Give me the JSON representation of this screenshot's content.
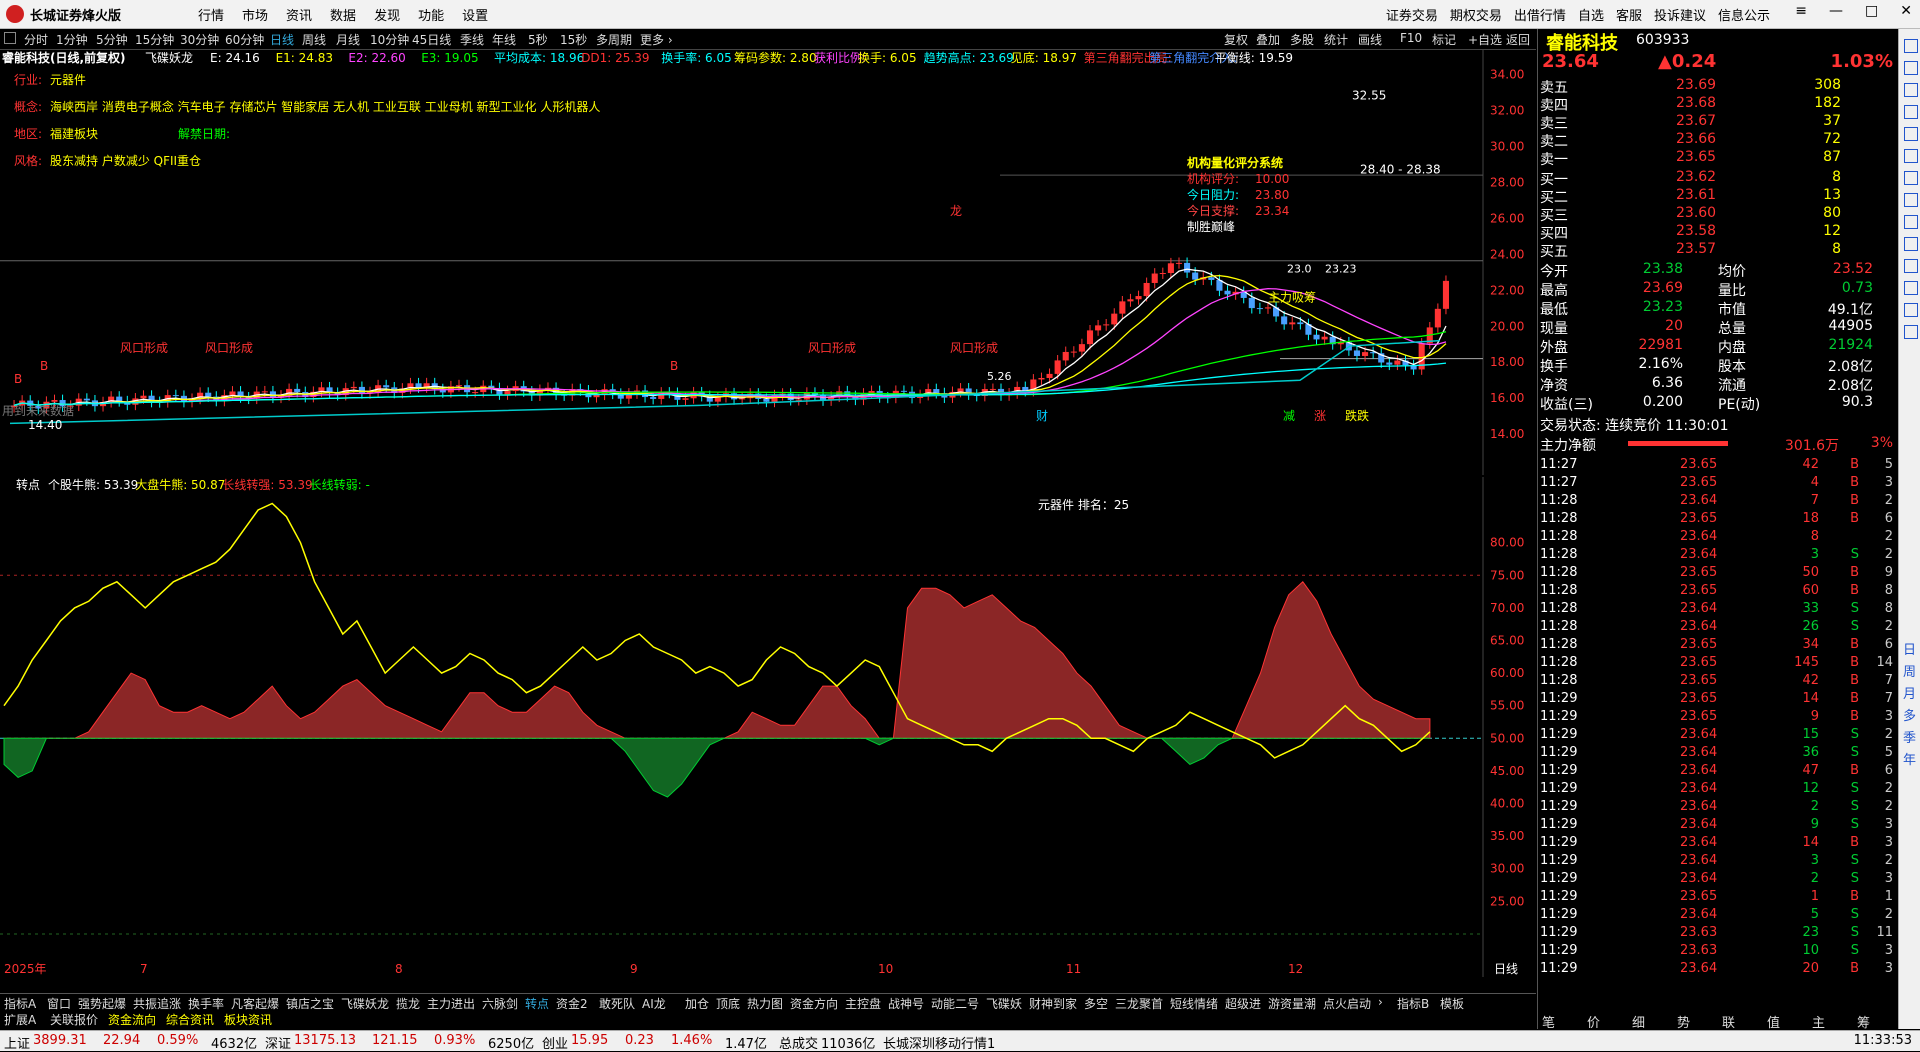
{
  "app": {
    "title": "长城证券烽火版"
  },
  "mainmenu": [
    "行情",
    "市场",
    "资讯",
    "数据",
    "发现",
    "功能",
    "设置"
  ],
  "rightmenu": [
    "证券交易",
    "期权交易",
    "出借行情",
    "自选",
    "客服",
    "投诉建议",
    "信息公示"
  ],
  "window_buttons": [
    "≡",
    "—",
    "□",
    "✕"
  ],
  "periods": [
    "分时",
    "1分钟",
    "5分钟",
    "15分钟",
    "30分钟",
    "60分钟",
    "日线",
    "周线",
    "月线",
    "10分钟",
    "45日线",
    "季线",
    "年线",
    "5秒",
    "15秒",
    "多周期",
    "更多 ›"
  ],
  "active_period": "日线",
  "toolbar": [
    "复权",
    "叠加",
    "多股",
    "统计",
    "画线",
    "F10",
    "标记",
    "+自选",
    "返回"
  ],
  "main_header": {
    "stock": "睿能科技(日线,前复权)",
    "indicator": "飞碟妖龙",
    "items": [
      {
        "t": "E: 24.16",
        "c": "#ffffff"
      },
      {
        "t": "E1: 24.83",
        "c": "#ffff00"
      },
      {
        "t": "E2: 22.60",
        "c": "#ff44ff"
      },
      {
        "t": "E3: 19.05",
        "c": "#00ff00"
      },
      {
        "t": "平均成本: 18.96",
        "c": "#00ffff"
      },
      {
        "t": "DD1: 25.39",
        "c": "#ff3333"
      },
      {
        "t": "换手率: 6.05",
        "c": "#00ffff"
      },
      {
        "t": "筹码参数: 2.80",
        "c": "#ffff00"
      },
      {
        "t": "获利比例:",
        "c": "#ff44ff"
      },
      {
        "t": "换手: 6.05",
        "c": "#ffff00"
      },
      {
        "t": "趋势高点: 23.69",
        "c": "#00ffff"
      },
      {
        "t": "见底: 18.97",
        "c": "#ffff00"
      },
      {
        "t": "第三角翻完出局:",
        "c": "#ff3333"
      },
      {
        "t": "第三角翻完介入:",
        "c": "#4488ff"
      },
      {
        "t": "平衡线: 19.59",
        "c": "#ffffff"
      }
    ]
  },
  "info_lines": [
    {
      "label": "行业:",
      "value": "元器件"
    },
    {
      "label": "概念:",
      "value": "海峡西岸 消费电子概念 汽车电子 存储芯片 智能家居 无人机 工业互联 工业母机 新型工业化 人形机器人"
    },
    {
      "label": "地区:",
      "value": "福建板块",
      "extra": "解禁日期:"
    },
    {
      "label": "风格:",
      "value": "股东减持 户数减少 QFII重仓"
    }
  ],
  "overlay": {
    "title": "机构量化评分系统",
    "rows": [
      {
        "k": "机构评分:",
        "v": "10.00"
      },
      {
        "k": "今日阻力:",
        "v": "23.80"
      },
      {
        "k": "今日支撑:",
        "v": "23.34"
      },
      {
        "k": "制胜巅峰",
        "v": ""
      }
    ]
  },
  "price_labels": {
    "high": "32.55",
    "range": "28.40 - 28.38",
    "low": "14.40",
    "mid": "23.0",
    "mid2": "23.23",
    "p1": "5.26"
  },
  "chart_annotations": [
    "风口形成",
    "风口形成",
    "风口形成",
    "风口形成",
    "主力吸筹",
    "B",
    "B",
    "B",
    "龙",
    "用到未来数据",
    "财",
    "减",
    "涨",
    "跌跌"
  ],
  "main_yaxis": [
    "34.00",
    "32.00",
    "30.00",
    "28.00",
    "26.00",
    "24.00",
    "22.00",
    "20.00",
    "18.00",
    "16.00",
    "14.00"
  ],
  "sub_header": {
    "name": "转点",
    "items": [
      {
        "t": "个股牛熊: 53.39",
        "c": "#ffffff"
      },
      {
        "t": "大盘牛熊: 50.87",
        "c": "#ffff00"
      },
      {
        "t": "长线转强: 53.39",
        "c": "#ff3333"
      },
      {
        "t": "长线转弱: -",
        "c": "#00ff00"
      }
    ]
  },
  "sub_center": "元器件    排名：25",
  "sub_yaxis": [
    "80.00",
    "75.00",
    "70.00",
    "65.00",
    "60.00",
    "55.00",
    "50.00",
    "45.00",
    "40.00",
    "35.00",
    "30.00",
    "25.00"
  ],
  "xaxis_dates": [
    "2025年",
    "7",
    "8",
    "9",
    "10",
    "11",
    "12"
  ],
  "xaxis_right": "日线",
  "bottom_tabs": [
    "指标A",
    "窗口",
    "强势起爆",
    "共振追涨",
    "换手率",
    "凡客起爆",
    "镇店之宝",
    "飞碟妖龙",
    "揽龙",
    "主力进出",
    "六脉剑",
    "转点",
    "资金2",
    "敢死队",
    "AI龙",
    "加仓",
    "顶底",
    "热力图",
    "资金方向",
    "主控盘",
    "战神号",
    "动能二号",
    "飞碟妖",
    "财神到家",
    "多空",
    "三龙聚首",
    "短线情绪",
    "超级进",
    "游资量潮",
    "点火启动",
    "›",
    "指标B",
    "模板"
  ],
  "active_bottom_tab": "转点",
  "bottom_tabs2": [
    "扩展A",
    "关联报价",
    "资金流向",
    "综合资讯",
    "板块资讯"
  ],
  "quote": {
    "name": "睿能科技",
    "code": "603933",
    "price": "23.64",
    "change": "▲0.24",
    "pct": "1.03%",
    "asks": [
      {
        "l": "卖五",
        "p": "23.69",
        "v": "308"
      },
      {
        "l": "卖四",
        "p": "23.68",
        "v": "182"
      },
      {
        "l": "卖三",
        "p": "23.67",
        "v": "37"
      },
      {
        "l": "卖二",
        "p": "23.66",
        "v": "72"
      },
      {
        "l": "卖一",
        "p": "23.65",
        "v": "87"
      }
    ],
    "bids": [
      {
        "l": "买一",
        "p": "23.62",
        "v": "8"
      },
      {
        "l": "买二",
        "p": "23.61",
        "v": "13"
      },
      {
        "l": "买三",
        "p": "23.60",
        "v": "80"
      },
      {
        "l": "买四",
        "p": "23.58",
        "v": "12"
      },
      {
        "l": "买五",
        "p": "23.57",
        "v": "8"
      }
    ],
    "stats": [
      {
        "k1": "今开",
        "v1": "23.38",
        "c1": "#00cc33",
        "k2": "均价",
        "v2": "23.52",
        "c2": "#ff3333"
      },
      {
        "k1": "最高",
        "v1": "23.69",
        "c1": "#ff3333",
        "k2": "量比",
        "v2": "0.73",
        "c2": "#00cc33"
      },
      {
        "k1": "最低",
        "v1": "23.23",
        "c1": "#00cc33",
        "k2": "市值",
        "v2": "49.1亿",
        "c2": "#ffffff"
      },
      {
        "k1": "现量",
        "v1": "20",
        "c1": "#ff3333",
        "k2": "总量",
        "v2": "44905",
        "c2": "#ffffff"
      },
      {
        "k1": "外盘",
        "v1": "22981",
        "c1": "#ff3333",
        "k2": "内盘",
        "v2": "21924",
        "c2": "#00cc33"
      },
      {
        "k1": "换手",
        "v1": "2.16%",
        "c1": "#ffffff",
        "k2": "股本",
        "v2": "2.08亿",
        "c2": "#ffffff"
      },
      {
        "k1": "净资",
        "v1": "6.36",
        "c1": "#ffffff",
        "k2": "流通",
        "v2": "2.08亿",
        "c2": "#ffffff"
      },
      {
        "k1": "收益(三)",
        "v1": "0.200",
        "c1": "#ffffff",
        "k2": "PE(动)",
        "v2": "90.3",
        "c2": "#ffffff"
      }
    ],
    "trade_status": "交易状态: 连续竞价 11:30:01",
    "main_flow_label": "主力净额",
    "main_flow_value": "301.6万",
    "main_flow_pct": "3%",
    "ticks": [
      {
        "t": "11:27",
        "p": "23.65",
        "v": "42",
        "d": "B",
        "n": "5"
      },
      {
        "t": "11:27",
        "p": "23.65",
        "v": "4",
        "d": "B",
        "n": "3"
      },
      {
        "t": "11:28",
        "p": "23.64",
        "v": "7",
        "d": "B",
        "n": "2"
      },
      {
        "t": "11:28",
        "p": "23.65",
        "v": "18",
        "d": "B",
        "n": "6"
      },
      {
        "t": "11:28",
        "p": "23.64",
        "v": "8",
        "d": "",
        "n": "2"
      },
      {
        "t": "11:28",
        "p": "23.64",
        "v": "3",
        "d": "S",
        "n": "2"
      },
      {
        "t": "11:28",
        "p": "23.65",
        "v": "50",
        "d": "B",
        "n": "9"
      },
      {
        "t": "11:28",
        "p": "23.65",
        "v": "60",
        "d": "B",
        "n": "8"
      },
      {
        "t": "11:28",
        "p": "23.64",
        "v": "33",
        "d": "S",
        "n": "8"
      },
      {
        "t": "11:28",
        "p": "23.64",
        "v": "26",
        "d": "S",
        "n": "2"
      },
      {
        "t": "11:28",
        "p": "23.65",
        "v": "34",
        "d": "B",
        "n": "6"
      },
      {
        "t": "11:28",
        "p": "23.65",
        "v": "145",
        "d": "B",
        "n": "14"
      },
      {
        "t": "11:28",
        "p": "23.65",
        "v": "42",
        "d": "B",
        "n": "7"
      },
      {
        "t": "11:29",
        "p": "23.65",
        "v": "14",
        "d": "B",
        "n": "7"
      },
      {
        "t": "11:29",
        "p": "23.65",
        "v": "9",
        "d": "B",
        "n": "3"
      },
      {
        "t": "11:29",
        "p": "23.64",
        "v": "15",
        "d": "S",
        "n": "2"
      },
      {
        "t": "11:29",
        "p": "23.64",
        "v": "36",
        "d": "S",
        "n": "5"
      },
      {
        "t": "11:29",
        "p": "23.64",
        "v": "47",
        "d": "B",
        "n": "6"
      },
      {
        "t": "11:29",
        "p": "23.64",
        "v": "12",
        "d": "S",
        "n": "2"
      },
      {
        "t": "11:29",
        "p": "23.64",
        "v": "2",
        "d": "S",
        "n": "2"
      },
      {
        "t": "11:29",
        "p": "23.64",
        "v": "9",
        "d": "S",
        "n": "3"
      },
      {
        "t": "11:29",
        "p": "23.64",
        "v": "14",
        "d": "B",
        "n": "3"
      },
      {
        "t": "11:29",
        "p": "23.64",
        "v": "3",
        "d": "S",
        "n": "2"
      },
      {
        "t": "11:29",
        "p": "23.64",
        "v": "2",
        "d": "S",
        "n": "3"
      },
      {
        "t": "11:29",
        "p": "23.65",
        "v": "1",
        "d": "B",
        "n": "1"
      },
      {
        "t": "11:29",
        "p": "23.64",
        "v": "5",
        "d": "S",
        "n": "2"
      },
      {
        "t": "11:29",
        "p": "23.63",
        "v": "23",
        "d": "S",
        "n": "11"
      },
      {
        "t": "11:29",
        "p": "23.63",
        "v": "10",
        "d": "S",
        "n": "3"
      },
      {
        "t": "11:29",
        "p": "23.64",
        "v": "20",
        "d": "B",
        "n": "3"
      }
    ],
    "bottom_tabs": [
      "笔",
      "价",
      "细",
      "势",
      "联",
      "值",
      "主",
      "筹"
    ]
  },
  "sidebar_items": [
    "日",
    "周",
    "月",
    "多",
    "季",
    "年"
  ],
  "status": {
    "items": [
      {
        "k": "上证",
        "v": "3899.31",
        "c": "#cc0000"
      },
      {
        "k": "",
        "v": "22.94",
        "c": "#cc0000"
      },
      {
        "k": "",
        "v": "0.59%",
        "c": "#cc0000"
      },
      {
        "k": "",
        "v": "4632亿",
        "c": "#000000"
      },
      {
        "k": "深证",
        "v": "13175.13",
        "c": "#cc0000"
      },
      {
        "k": "",
        "v": "121.15",
        "c": "#cc0000"
      },
      {
        "k": "",
        "v": "0.93%",
        "c": "#cc0000"
      },
      {
        "k": "",
        "v": "6250亿",
        "c": "#000000"
      },
      {
        "k": "创业",
        "v": "15.95",
        "c": "#cc0000"
      },
      {
        "k": "",
        "v": "0.23",
        "c": "#cc0000"
      },
      {
        "k": "",
        "v": "1.46%",
        "c": "#cc0000"
      },
      {
        "k": "",
        "v": "1.47亿",
        "c": "#000000"
      },
      {
        "k": "总成交",
        "v": "11036亿",
        "c": "#000000"
      },
      {
        "k": "",
        "v": "长城深圳移动行情1",
        "c": "#000000"
      }
    ],
    "time": "11:33:53"
  },
  "colors": {
    "up": "#ff3333",
    "down": "#00cc33",
    "accent": "#3ad"
  }
}
